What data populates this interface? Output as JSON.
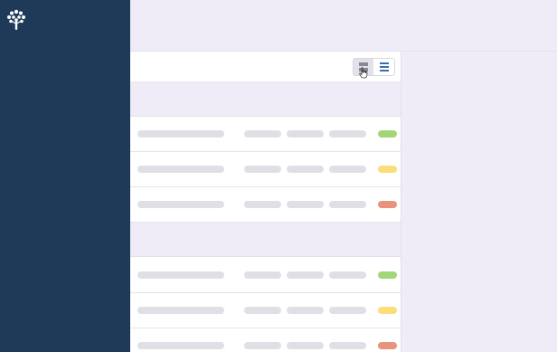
{
  "sidebar": {
    "logo_icon": "tree-icon",
    "background": "#1f3a58"
  },
  "toolbar": {
    "view_toggle": {
      "options": [
        {
          "icon": "card-view-icon",
          "active": true
        },
        {
          "icon": "list-view-icon",
          "active": false
        }
      ]
    }
  },
  "groups": [
    {
      "rows": [
        {
          "status": "green"
        },
        {
          "status": "yellow"
        },
        {
          "status": "red"
        }
      ]
    },
    {
      "rows": [
        {
          "status": "green"
        },
        {
          "status": "yellow"
        },
        {
          "status": "red"
        }
      ]
    }
  ],
  "colors": {
    "green": "#a3d677",
    "yellow": "#fbdd7a",
    "red": "#e9937d",
    "placeholder": "#e1dfe5",
    "accent": "#3a6db5"
  }
}
